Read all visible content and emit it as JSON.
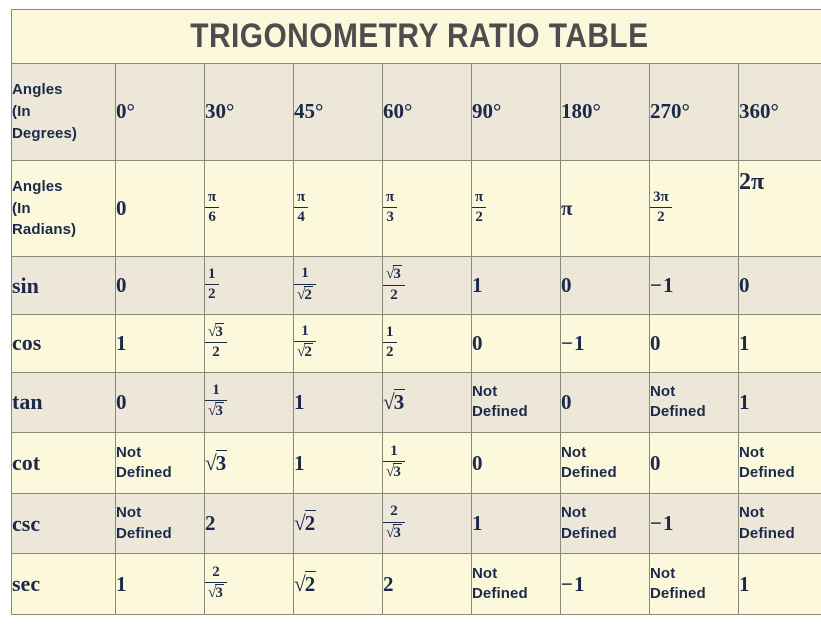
{
  "title": "TRIGONOMETRY RATIO TABLE",
  "colors": {
    "page_background": "#FFFFFF",
    "row_beige": "#EDE7DA",
    "row_cream": "#FBF8DC",
    "border": "#8A8A78",
    "text_navy": "#1B2A4A",
    "title_gray": "#4D4D4D"
  },
  "columns": {
    "label_header": "",
    "degrees": [
      "0°",
      "30°",
      "45°",
      "60°",
      "90°",
      "180°",
      "270°",
      "360°"
    ]
  },
  "rows": {
    "angles_degrees": {
      "label": "Angles\n(In\nDegrees)",
      "values": [
        "0°",
        "30°",
        "45°",
        "60°",
        "90°",
        "180°",
        "270°",
        "360°"
      ]
    },
    "angles_radians": {
      "label": "Angles\n(In\nRadians)",
      "values": [
        "0",
        "π/6",
        "π/4",
        "π/3",
        "π/2",
        "π",
        "3π/2",
        "2π"
      ]
    },
    "sin": {
      "label": "sin",
      "values": [
        "0",
        "1/2",
        "1/√2",
        "√3/2",
        "1",
        "0",
        "−1",
        "0"
      ]
    },
    "cos": {
      "label": "cos",
      "values": [
        "1",
        "√3/2",
        "1/√2",
        "1/2",
        "0",
        "−1",
        "0",
        "1"
      ]
    },
    "tan": {
      "label": "tan",
      "values": [
        "0",
        "1/√3",
        "1",
        "√3",
        "Not Defined",
        "0",
        "Not Defined",
        "1"
      ]
    },
    "cot": {
      "label": "cot",
      "values": [
        "Not Defined",
        "√3",
        "1",
        "1/√3",
        "0",
        "Not Defined",
        "0",
        "Not Defined"
      ]
    },
    "csc": {
      "label": "csc",
      "values": [
        "Not Defined",
        "2",
        "√2",
        "2/√3",
        "1",
        "Not Defined",
        "−1",
        "Not Defined"
      ]
    },
    "sec": {
      "label": "sec",
      "values": [
        "1",
        "2/√3",
        "√2",
        "2",
        "Not Defined",
        "−1",
        "Not Defined",
        "1"
      ]
    }
  },
  "not_defined_text": "Not\nDefined"
}
